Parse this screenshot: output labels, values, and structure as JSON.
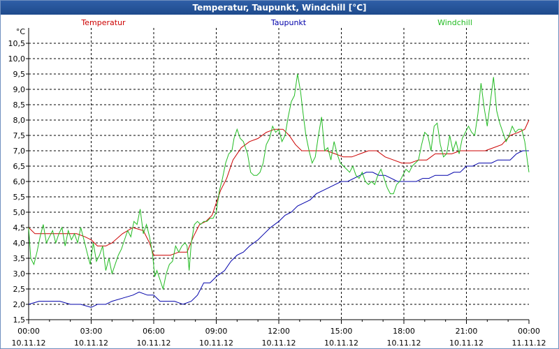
{
  "window": {
    "title": "Temperatur, Taupunkt, Windchill [°C]"
  },
  "chart_data": {
    "type": "line",
    "title": "Temperatur, Taupunkt, Windchill [°C]",
    "ylabel": "°C",
    "ylim": [
      1.5,
      11.0
    ],
    "y_ticks": [
      "1,5",
      "2,0",
      "2,5",
      "3,0",
      "3,5",
      "4,0",
      "4,5",
      "5,0",
      "5,5",
      "6,0",
      "6,5",
      "7,0",
      "7,5",
      "8,0",
      "8,5",
      "9,0",
      "9,5",
      "10,0",
      "10,5"
    ],
    "y_tick_values": [
      1.5,
      2.0,
      2.5,
      3.0,
      3.5,
      4.0,
      4.5,
      5.0,
      5.5,
      6.0,
      6.5,
      7.0,
      7.5,
      8.0,
      8.5,
      9.0,
      9.5,
      10.0,
      10.5
    ],
    "xlim": [
      0,
      24
    ],
    "x_ticks": [
      {
        "x": 0,
        "time": "00:00",
        "date": "10.11.12"
      },
      {
        "x": 3,
        "time": "03:00",
        "date": "10.11.12"
      },
      {
        "x": 6,
        "time": "06:00",
        "date": "10.11.12"
      },
      {
        "x": 9,
        "time": "09:00",
        "date": "10.11.12"
      },
      {
        "x": 12,
        "time": "12:00",
        "date": "10.11.12"
      },
      {
        "x": 15,
        "time": "15:00",
        "date": "10.11.12"
      },
      {
        "x": 18,
        "time": "18:00",
        "date": "10.11.12"
      },
      {
        "x": 21,
        "time": "21:00",
        "date": "10.11.12"
      },
      {
        "x": 24,
        "time": "00:00",
        "date": "11.11.12"
      }
    ],
    "grid": true,
    "legend_placement": "top",
    "series": [
      {
        "name": "Temperatur",
        "color": "#cc0000",
        "points": [
          [
            0,
            4.5
          ],
          [
            0.3,
            4.3
          ],
          [
            0.8,
            4.3
          ],
          [
            1.2,
            4.3
          ],
          [
            1.8,
            4.3
          ],
          [
            2.3,
            4.3
          ],
          [
            2.7,
            4.2
          ],
          [
            3.0,
            4.1
          ],
          [
            3.3,
            3.9
          ],
          [
            3.7,
            3.9
          ],
          [
            4.0,
            4.0
          ],
          [
            4.5,
            4.3
          ],
          [
            5.0,
            4.5
          ],
          [
            5.5,
            4.4
          ],
          [
            5.8,
            4.0
          ],
          [
            6.0,
            3.6
          ],
          [
            6.4,
            3.6
          ],
          [
            6.8,
            3.6
          ],
          [
            7.2,
            3.7
          ],
          [
            7.6,
            3.7
          ],
          [
            7.9,
            4.2
          ],
          [
            8.2,
            4.6
          ],
          [
            8.5,
            4.7
          ],
          [
            8.8,
            4.9
          ],
          [
            9.2,
            5.7
          ],
          [
            9.5,
            6.1
          ],
          [
            9.8,
            6.7
          ],
          [
            10.2,
            7.1
          ],
          [
            10.6,
            7.3
          ],
          [
            11.0,
            7.4
          ],
          [
            11.4,
            7.6
          ],
          [
            11.8,
            7.7
          ],
          [
            12.2,
            7.7
          ],
          [
            12.5,
            7.5
          ],
          [
            12.8,
            7.2
          ],
          [
            13.1,
            7.0
          ],
          [
            13.5,
            7.0
          ],
          [
            13.9,
            7.0
          ],
          [
            14.3,
            7.0
          ],
          [
            14.7,
            6.9
          ],
          [
            15.1,
            6.8
          ],
          [
            15.5,
            6.8
          ],
          [
            15.9,
            6.9
          ],
          [
            16.3,
            7.0
          ],
          [
            16.7,
            7.0
          ],
          [
            17.1,
            6.8
          ],
          [
            17.5,
            6.7
          ],
          [
            17.9,
            6.6
          ],
          [
            18.3,
            6.6
          ],
          [
            18.7,
            6.7
          ],
          [
            19.1,
            6.7
          ],
          [
            19.5,
            6.9
          ],
          [
            19.9,
            6.9
          ],
          [
            20.3,
            6.9
          ],
          [
            20.7,
            7.0
          ],
          [
            21.1,
            7.0
          ],
          [
            21.5,
            7.0
          ],
          [
            21.9,
            7.0
          ],
          [
            22.3,
            7.1
          ],
          [
            22.7,
            7.2
          ],
          [
            23.1,
            7.5
          ],
          [
            23.5,
            7.6
          ],
          [
            23.8,
            7.7
          ],
          [
            24.0,
            8.0
          ]
        ]
      },
      {
        "name": "Taupunkt",
        "color": "#0000aa",
        "points": [
          [
            0,
            2.0
          ],
          [
            0.5,
            2.1
          ],
          [
            1.0,
            2.1
          ],
          [
            1.5,
            2.1
          ],
          [
            2.0,
            2.0
          ],
          [
            2.5,
            2.0
          ],
          [
            3.0,
            1.9
          ],
          [
            3.3,
            2.0
          ],
          [
            3.7,
            2.0
          ],
          [
            4.0,
            2.1
          ],
          [
            4.5,
            2.2
          ],
          [
            5.0,
            2.3
          ],
          [
            5.3,
            2.4
          ],
          [
            5.7,
            2.3
          ],
          [
            6.0,
            2.3
          ],
          [
            6.3,
            2.1
          ],
          [
            6.7,
            2.1
          ],
          [
            7.0,
            2.1
          ],
          [
            7.4,
            2.0
          ],
          [
            7.8,
            2.1
          ],
          [
            8.1,
            2.3
          ],
          [
            8.4,
            2.7
          ],
          [
            8.7,
            2.7
          ],
          [
            9.0,
            2.9
          ],
          [
            9.4,
            3.1
          ],
          [
            9.7,
            3.4
          ],
          [
            10.0,
            3.6
          ],
          [
            10.3,
            3.7
          ],
          [
            10.6,
            3.9
          ],
          [
            11.0,
            4.1
          ],
          [
            11.3,
            4.3
          ],
          [
            11.6,
            4.5
          ],
          [
            12.0,
            4.7
          ],
          [
            12.3,
            4.9
          ],
          [
            12.6,
            5.0
          ],
          [
            12.9,
            5.2
          ],
          [
            13.2,
            5.3
          ],
          [
            13.5,
            5.4
          ],
          [
            13.8,
            5.6
          ],
          [
            14.1,
            5.7
          ],
          [
            14.4,
            5.8
          ],
          [
            14.7,
            5.9
          ],
          [
            15.0,
            6.0
          ],
          [
            15.3,
            6.0
          ],
          [
            15.6,
            6.1
          ],
          [
            15.9,
            6.2
          ],
          [
            16.2,
            6.3
          ],
          [
            16.5,
            6.3
          ],
          [
            16.8,
            6.2
          ],
          [
            17.1,
            6.2
          ],
          [
            17.4,
            6.1
          ],
          [
            17.7,
            6.0
          ],
          [
            18.0,
            6.0
          ],
          [
            18.3,
            6.0
          ],
          [
            18.6,
            6.0
          ],
          [
            18.9,
            6.1
          ],
          [
            19.2,
            6.1
          ],
          [
            19.5,
            6.2
          ],
          [
            19.8,
            6.2
          ],
          [
            20.1,
            6.2
          ],
          [
            20.4,
            6.3
          ],
          [
            20.7,
            6.3
          ],
          [
            21.0,
            6.5
          ],
          [
            21.3,
            6.5
          ],
          [
            21.6,
            6.6
          ],
          [
            21.9,
            6.6
          ],
          [
            22.2,
            6.6
          ],
          [
            22.5,
            6.7
          ],
          [
            22.8,
            6.7
          ],
          [
            23.1,
            6.7
          ],
          [
            23.4,
            6.9
          ],
          [
            23.7,
            7.0
          ],
          [
            24.0,
            7.0
          ]
        ]
      },
      {
        "name": "Windchill",
        "color": "#22bb22",
        "points": [
          [
            0,
            4.5
          ],
          [
            0.1,
            3.5
          ],
          [
            0.25,
            3.3
          ],
          [
            0.4,
            3.7
          ],
          [
            0.55,
            4.2
          ],
          [
            0.7,
            4.6
          ],
          [
            0.85,
            4.0
          ],
          [
            1.0,
            4.2
          ],
          [
            1.15,
            4.4
          ],
          [
            1.3,
            4.0
          ],
          [
            1.45,
            4.3
          ],
          [
            1.6,
            4.5
          ],
          [
            1.75,
            3.9
          ],
          [
            1.9,
            4.4
          ],
          [
            2.05,
            4.1
          ],
          [
            2.2,
            4.3
          ],
          [
            2.35,
            4.0
          ],
          [
            2.5,
            4.5
          ],
          [
            2.65,
            4.1
          ],
          [
            2.8,
            3.7
          ],
          [
            2.95,
            3.3
          ],
          [
            3.1,
            4.0
          ],
          [
            3.25,
            3.4
          ],
          [
            3.4,
            3.6
          ],
          [
            3.55,
            3.9
          ],
          [
            3.7,
            3.1
          ],
          [
            3.85,
            3.5
          ],
          [
            4.0,
            3.0
          ],
          [
            4.15,
            3.3
          ],
          [
            4.3,
            3.6
          ],
          [
            4.45,
            3.8
          ],
          [
            4.6,
            4.1
          ],
          [
            4.75,
            4.4
          ],
          [
            4.9,
            4.2
          ],
          [
            5.05,
            4.7
          ],
          [
            5.2,
            4.6
          ],
          [
            5.35,
            5.1
          ],
          [
            5.5,
            4.3
          ],
          [
            5.65,
            4.6
          ],
          [
            5.8,
            4.2
          ],
          [
            5.95,
            3.6
          ],
          [
            6.05,
            2.9
          ],
          [
            6.15,
            3.1
          ],
          [
            6.3,
            2.8
          ],
          [
            6.45,
            2.5
          ],
          [
            6.6,
            3.0
          ],
          [
            6.75,
            3.3
          ],
          [
            6.9,
            3.4
          ],
          [
            7.05,
            3.9
          ],
          [
            7.2,
            3.7
          ],
          [
            7.35,
            3.9
          ],
          [
            7.5,
            4.0
          ],
          [
            7.6,
            3.9
          ],
          [
            7.7,
            3.1
          ],
          [
            7.8,
            4.0
          ],
          [
            7.95,
            4.6
          ],
          [
            8.1,
            4.7
          ],
          [
            8.25,
            4.6
          ],
          [
            8.4,
            4.7
          ],
          [
            8.55,
            4.7
          ],
          [
            8.7,
            4.8
          ],
          [
            8.85,
            4.8
          ],
          [
            9.0,
            5.0
          ],
          [
            9.15,
            5.7
          ],
          [
            9.3,
            6.1
          ],
          [
            9.45,
            6.6
          ],
          [
            9.6,
            6.9
          ],
          [
            9.75,
            7.0
          ],
          [
            9.85,
            7.4
          ],
          [
            10.0,
            7.7
          ],
          [
            10.15,
            7.4
          ],
          [
            10.3,
            7.3
          ],
          [
            10.4,
            7.1
          ],
          [
            10.5,
            6.9
          ],
          [
            10.65,
            6.3
          ],
          [
            10.8,
            6.2
          ],
          [
            10.95,
            6.2
          ],
          [
            11.1,
            6.3
          ],
          [
            11.25,
            6.6
          ],
          [
            11.4,
            7.2
          ],
          [
            11.55,
            7.4
          ],
          [
            11.7,
            7.8
          ],
          [
            11.85,
            7.6
          ],
          [
            12.0,
            7.7
          ],
          [
            12.15,
            7.3
          ],
          [
            12.3,
            7.5
          ],
          [
            12.45,
            8.1
          ],
          [
            12.6,
            8.6
          ],
          [
            12.75,
            8.8
          ],
          [
            12.9,
            9.5
          ],
          [
            13.05,
            8.9
          ],
          [
            13.15,
            8.3
          ],
          [
            13.3,
            7.5
          ],
          [
            13.45,
            7.0
          ],
          [
            13.6,
            6.6
          ],
          [
            13.75,
            6.8
          ],
          [
            13.9,
            7.5
          ],
          [
            14.05,
            8.1
          ],
          [
            14.2,
            7.0
          ],
          [
            14.35,
            7.1
          ],
          [
            14.5,
            6.7
          ],
          [
            14.65,
            7.3
          ],
          [
            14.8,
            6.9
          ],
          [
            14.95,
            6.6
          ],
          [
            15.1,
            6.5
          ],
          [
            15.25,
            6.4
          ],
          [
            15.4,
            6.3
          ],
          [
            15.55,
            6.5
          ],
          [
            15.7,
            6.2
          ],
          [
            15.85,
            6.1
          ],
          [
            16.0,
            6.3
          ],
          [
            16.15,
            6.0
          ],
          [
            16.3,
            5.9
          ],
          [
            16.45,
            6.0
          ],
          [
            16.6,
            5.9
          ],
          [
            16.75,
            6.2
          ],
          [
            16.9,
            6.4
          ],
          [
            17.05,
            6.1
          ],
          [
            17.2,
            5.8
          ],
          [
            17.35,
            5.6
          ],
          [
            17.5,
            5.6
          ],
          [
            17.65,
            5.9
          ],
          [
            17.8,
            6.0
          ],
          [
            17.95,
            6.2
          ],
          [
            18.1,
            6.4
          ],
          [
            18.25,
            6.3
          ],
          [
            18.4,
            6.5
          ],
          [
            18.55,
            6.6
          ],
          [
            18.7,
            6.7
          ],
          [
            18.85,
            7.2
          ],
          [
            19.0,
            7.6
          ],
          [
            19.15,
            7.5
          ],
          [
            19.3,
            7.0
          ],
          [
            19.45,
            7.8
          ],
          [
            19.6,
            7.9
          ],
          [
            19.75,
            7.2
          ],
          [
            19.9,
            6.8
          ],
          [
            20.05,
            6.9
          ],
          [
            20.2,
            7.5
          ],
          [
            20.35,
            7.0
          ],
          [
            20.5,
            7.3
          ],
          [
            20.65,
            6.9
          ],
          [
            20.8,
            7.4
          ],
          [
            20.95,
            7.6
          ],
          [
            21.1,
            7.8
          ],
          [
            21.25,
            7.6
          ],
          [
            21.4,
            7.5
          ],
          [
            21.55,
            8.2
          ],
          [
            21.7,
            9.2
          ],
          [
            21.85,
            8.4
          ],
          [
            22.0,
            7.8
          ],
          [
            22.15,
            8.6
          ],
          [
            22.3,
            9.4
          ],
          [
            22.45,
            8.3
          ],
          [
            22.6,
            7.9
          ],
          [
            22.75,
            7.6
          ],
          [
            22.9,
            7.3
          ],
          [
            23.05,
            7.5
          ],
          [
            23.2,
            7.8
          ],
          [
            23.35,
            7.6
          ],
          [
            23.5,
            7.7
          ],
          [
            23.65,
            7.7
          ],
          [
            23.8,
            7.3
          ],
          [
            24.0,
            6.3
          ]
        ]
      }
    ]
  }
}
